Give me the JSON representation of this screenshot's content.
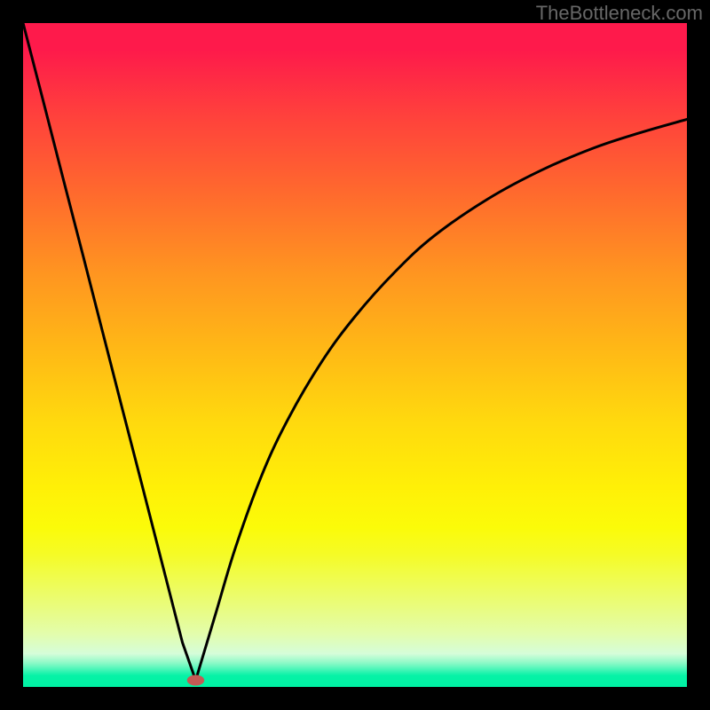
{
  "watermark": "TheBottleneck.com",
  "chart_data": {
    "type": "line",
    "title": "",
    "xlabel": "",
    "ylabel": "",
    "xlim": [
      0,
      1
    ],
    "ylim": [
      0,
      1
    ],
    "grid": false,
    "legend": false,
    "series": [
      {
        "name": "left-branch",
        "x": [
          0.0,
          0.03,
          0.06,
          0.09,
          0.12,
          0.15,
          0.18,
          0.21,
          0.24,
          0.26
        ],
        "y": [
          1.0,
          0.884,
          0.767,
          0.651,
          0.534,
          0.417,
          0.301,
          0.184,
          0.067,
          0.01
        ]
      },
      {
        "name": "right-branch",
        "x": [
          0.26,
          0.29,
          0.32,
          0.36,
          0.4,
          0.45,
          0.5,
          0.56,
          0.62,
          0.7,
          0.78,
          0.86,
          0.93,
          1.0
        ],
        "y": [
          0.01,
          0.11,
          0.21,
          0.32,
          0.405,
          0.49,
          0.558,
          0.625,
          0.68,
          0.735,
          0.778,
          0.812,
          0.835,
          0.855
        ]
      }
    ],
    "marker": {
      "x": 0.26,
      "y": 0.01,
      "rx": 0.013,
      "ry": 0.008,
      "color": "#c45a55"
    },
    "gradient_stops": [
      {
        "offset": 0.0,
        "color": "#fe1a4b"
      },
      {
        "offset": 0.5,
        "color": "#ffd90e"
      },
      {
        "offset": 0.8,
        "color": "#effc52"
      },
      {
        "offset": 1.0,
        "color": "#00f1a3"
      }
    ]
  }
}
